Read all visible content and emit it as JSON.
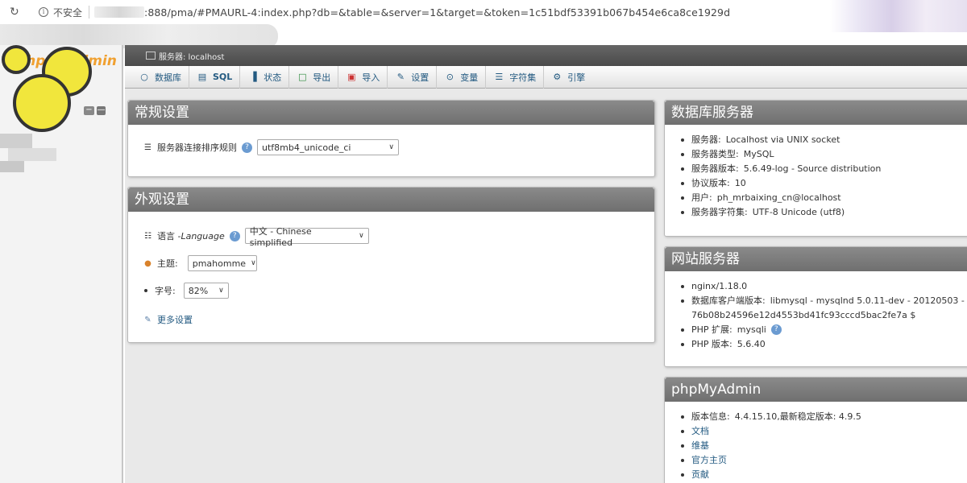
{
  "browser": {
    "insecure_label": "不安全",
    "url": ":888/pma/#PMAURL-4:index.php?db=&table=&server=1&target=&token=1c51bdf53391b067b454e6ca8ce1929d"
  },
  "server_bar": {
    "label": "服务器: localhost"
  },
  "tabs": [
    {
      "label": "数据库",
      "icon": "database-icon"
    },
    {
      "label": "SQL",
      "icon": "sql-icon"
    },
    {
      "label": "状态",
      "icon": "status-icon"
    },
    {
      "label": "导出",
      "icon": "export-icon"
    },
    {
      "label": "导入",
      "icon": "import-icon"
    },
    {
      "label": "设置",
      "icon": "settings-icon"
    },
    {
      "label": "变量",
      "icon": "variables-icon"
    },
    {
      "label": "字符集",
      "icon": "charset-icon"
    },
    {
      "label": "引擎",
      "icon": "engine-icon"
    }
  ],
  "general": {
    "title": "常规设置",
    "collation_label": "服务器连接排序规则",
    "collation_value": "utf8mb4_unicode_ci"
  },
  "appearance": {
    "title": "外观设置",
    "language_label": "语言 - ",
    "language_label_en": "Language",
    "language_value": "中文 - Chinese simplified",
    "theme_label": "主题:",
    "theme_value": "pmahomme",
    "fontsize_label": "字号:",
    "fontsize_value": "82%",
    "more_settings": "更多设置"
  },
  "db_server": {
    "title": "数据库服务器",
    "items": [
      {
        "label": "服务器:",
        "value": "Localhost via UNIX socket"
      },
      {
        "label": "服务器类型:",
        "value": "MySQL"
      },
      {
        "label": "服务器版本:",
        "value": "5.6.49-log - Source distribution"
      },
      {
        "label": "协议版本:",
        "value": "10"
      },
      {
        "label": "用户:",
        "value": "ph_mrbaixing_cn@localhost"
      },
      {
        "label": "服务器字符集:",
        "value": "UTF-8 Unicode (utf8)"
      }
    ]
  },
  "web_server": {
    "title": "网站服务器",
    "items": [
      {
        "label": "",
        "value": "nginx/1.18.0"
      },
      {
        "label": "数据库客户端版本:",
        "value": "libmysql - mysqlnd 5.0.11-dev - 20120503 -",
        "value2": "76b08b24596e12d4553bd41fc93cccd5bac2fe7a $"
      },
      {
        "label": "PHP 扩展:",
        "value": "mysqli"
      },
      {
        "label": "PHP 版本:",
        "value": "5.6.40"
      }
    ]
  },
  "pma": {
    "title": "phpMyAdmin",
    "version_label": "版本信息:",
    "version_value": "4.4.15.10,最新稳定版本: 4.9.5",
    "links": [
      "文档",
      "维基",
      "官方主页",
      "贡献"
    ]
  },
  "colors": {
    "link": "#235a81",
    "header": "#777777",
    "logo": "#f0a030"
  }
}
